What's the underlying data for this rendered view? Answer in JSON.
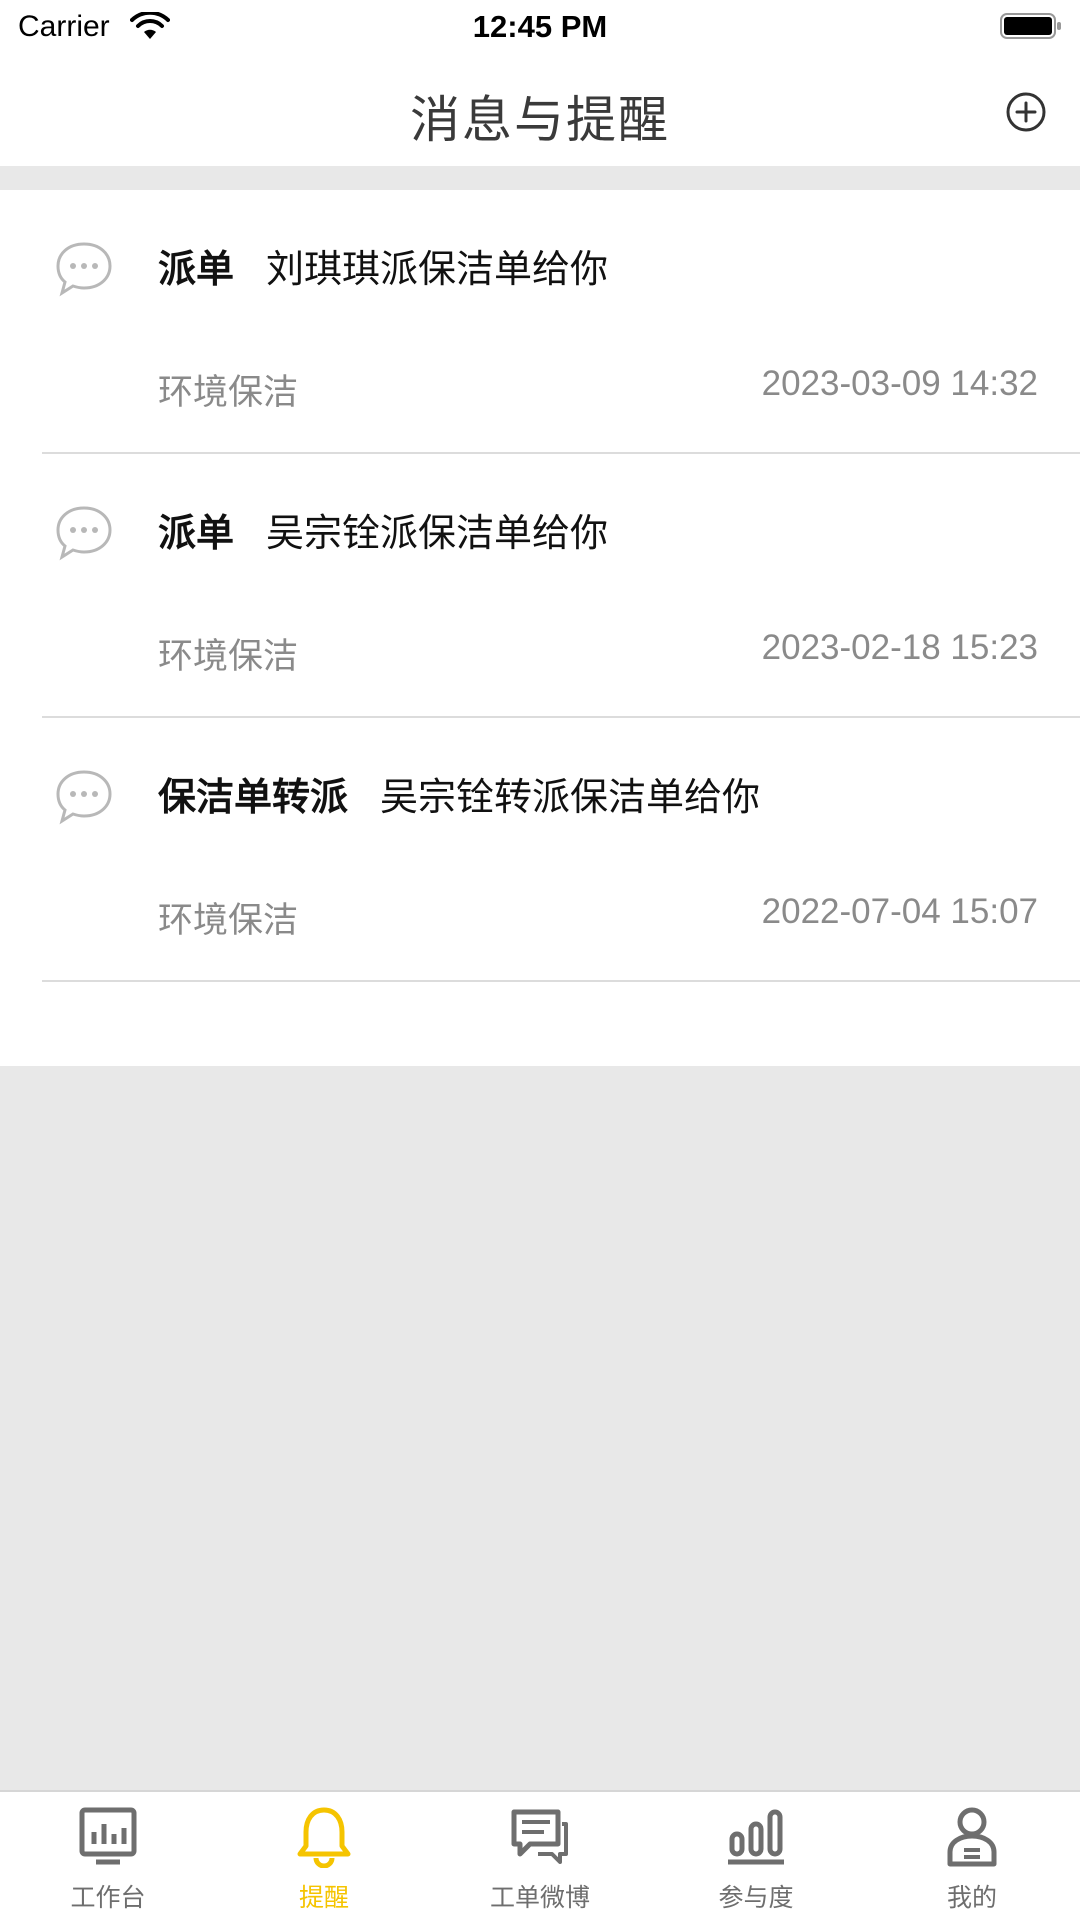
{
  "status_bar": {
    "carrier": "Carrier",
    "time": "12:45 PM"
  },
  "nav": {
    "title": "消息与提醒",
    "add_icon": "plus-circle-icon"
  },
  "messages": [
    {
      "type": "派单",
      "text": "刘琪琪派保洁单给你",
      "category": "环境保洁",
      "time": "2023-03-09 14:32"
    },
    {
      "type": "派单",
      "text": "吴宗铨派保洁单给你",
      "category": "环境保洁",
      "time": "2023-02-18 15:23"
    },
    {
      "type": "保洁单转派",
      "text": "吴宗铨转派保洁单给你",
      "category": "环境保洁",
      "time": "2022-07-04 15:07"
    }
  ],
  "tabs": [
    {
      "label": "工作台",
      "icon": "dashboard-icon",
      "active": false
    },
    {
      "label": "提醒",
      "icon": "bell-icon",
      "active": true
    },
    {
      "label": "工单微博",
      "icon": "chat-icon",
      "active": false
    },
    {
      "label": "参与度",
      "icon": "bar-chart-icon",
      "active": false
    },
    {
      "label": "我的",
      "icon": "user-icon",
      "active": false
    }
  ],
  "colors": {
    "accent": "#f5c400",
    "inactive": "#6e6e6e",
    "background": "#e8e8e8"
  }
}
